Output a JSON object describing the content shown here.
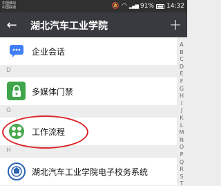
{
  "status_bar": {
    "carrier_line1": "中国移动",
    "carrier_line2": "中国联通",
    "battery": "91%",
    "time": "14:32"
  },
  "header": {
    "title": "湖北汽车工业学院"
  },
  "list": {
    "items": [
      {
        "label": "企业会话",
        "icon": "chat-bubble-icon",
        "color": "#3f7ef5"
      },
      {
        "label": "多媒体门禁",
        "icon": "lock-icon",
        "color": "#3fa54a"
      },
      {
        "label": "工作流程",
        "icon": "workflow-icon",
        "color": "#4aa84c"
      },
      {
        "label": "湖北汽车工业学院电子校务系统",
        "icon": "school-emblem-icon",
        "color": "#2b63b3"
      }
    ],
    "sections": [
      "D",
      "G",
      "H"
    ]
  },
  "index_letters": [
    "A",
    "B",
    "C",
    "D",
    "E",
    "F",
    "G",
    "H",
    "I",
    "J",
    "K",
    "L",
    "M",
    "N",
    "O",
    "P",
    "Q",
    "R",
    "S",
    "T"
  ],
  "colors": {
    "title_bar": "#393a3f",
    "status_bar": "#303030",
    "highlight": "#d9262a"
  }
}
